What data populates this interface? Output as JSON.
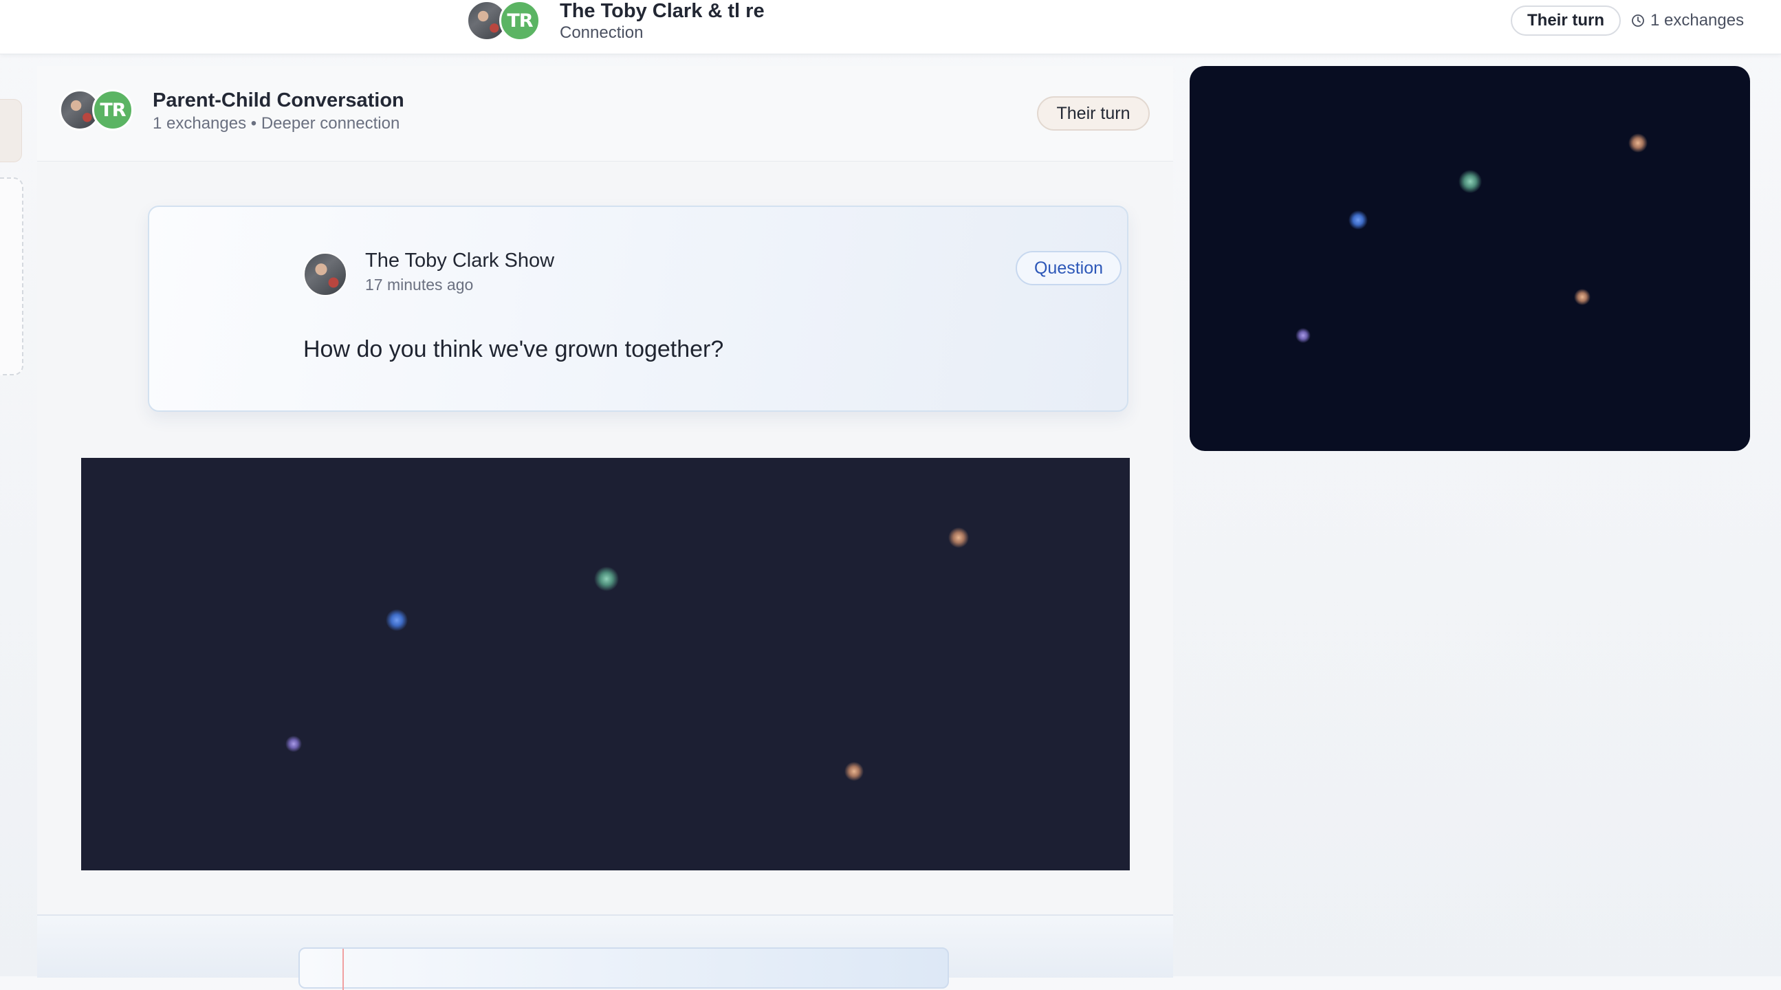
{
  "header": {
    "title": "The Toby Clark & tl re",
    "subtitle": "Connection",
    "avatar_initials": "TR",
    "turn_label": "Their turn",
    "exchanges_label": "1 exchanges",
    "clock_icon": "clock-icon"
  },
  "conversation": {
    "title": "Parent-Child Conversation",
    "meta": "1 exchanges • Deeper connection",
    "avatar_initials": "TR",
    "turn_label": "Their turn"
  },
  "message": {
    "author": "The Toby Clark Show",
    "time": "17 minutes ago",
    "tag": "Question",
    "text": "How do you think we've grown together?"
  },
  "colors": {
    "accent_blue": "#2c57b8",
    "avatar_green": "#5bb463",
    "starfield_main": "#1c1f33",
    "starfield_side": "#080d22"
  }
}
